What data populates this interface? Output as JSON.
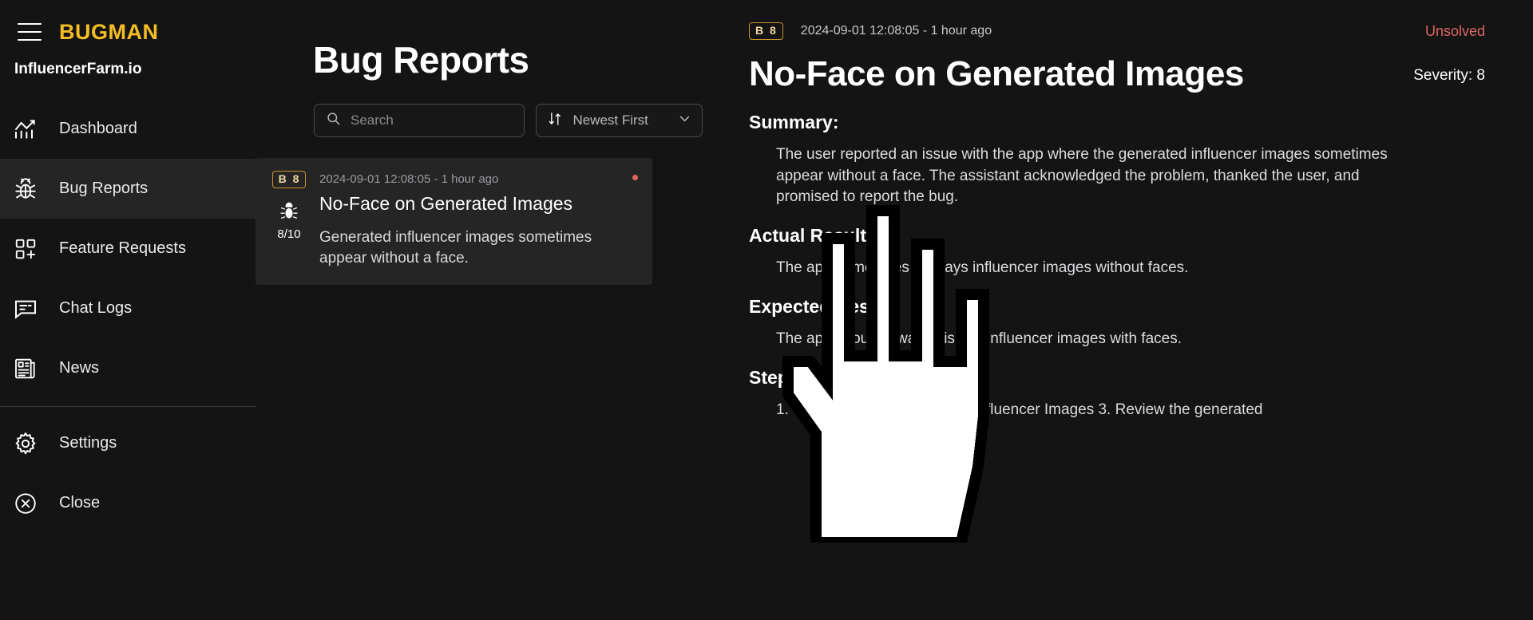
{
  "app": {
    "brand": "BUGMAN",
    "site": "InfluencerFarm.io",
    "menu_icon": "hamburger-icon",
    "accent": "#F5BD24",
    "danger": "#E06666",
    "bg": "#141414"
  },
  "sidebar": {
    "items": [
      {
        "label": "Dashboard",
        "icon": "chart-icon",
        "active": false
      },
      {
        "label": "Bug Reports",
        "icon": "bug-icon",
        "active": true
      },
      {
        "label": "Feature Requests",
        "icon": "grid-plus-icon",
        "active": false
      },
      {
        "label": "Chat Logs",
        "icon": "chat-icon",
        "active": false
      },
      {
        "label": "News",
        "icon": "news-icon",
        "active": false
      },
      {
        "label": "Settings",
        "icon": "gear-icon",
        "active": false
      },
      {
        "label": "Close",
        "icon": "close-circle-icon",
        "active": false
      }
    ]
  },
  "list": {
    "title": "Bug Reports",
    "search": {
      "placeholder": "Search",
      "value": "",
      "icon": "search-icon"
    },
    "sort": {
      "value": "Newest First",
      "icon": "sort-icon",
      "chevron": "chevron-down-icon"
    },
    "cards": [
      {
        "badge": "B 8",
        "severity_label": "8/10",
        "severity_num": "8",
        "severity_max": "/10",
        "timestamp": "2024-09-01 12:08:05 - 1 hour ago",
        "title": "No-Face on Generated Images",
        "description": "Generated influencer images sometimes appear without a face.",
        "unread": true,
        "selected": true
      }
    ]
  },
  "detail": {
    "badge": "B 8",
    "timestamp": "2024-09-01 12:08:05 - 1 hour ago",
    "status": "Unsolved",
    "title": "No-Face on Generated Images",
    "severity": "Severity: 8",
    "sections": [
      {
        "heading": "Summary:",
        "body": "The user reported an issue with the app where the generated influencer images sometimes appear without a face. The assistant acknowledged the problem, thanked the user, and promised to report the bug."
      },
      {
        "heading": "Actual Result:",
        "body": "The app sometimes displays influencer images without faces."
      },
      {
        "heading": "Expected Result:",
        "body": "The app should always display influencer images with faces."
      },
      {
        "heading": "Steps to Reproduce:",
        "body": "1. Open the app 2. Generate Influencer Images 3. Review the generated"
      }
    ]
  },
  "cursor": {
    "icon": "pointing-hand-cursor"
  }
}
